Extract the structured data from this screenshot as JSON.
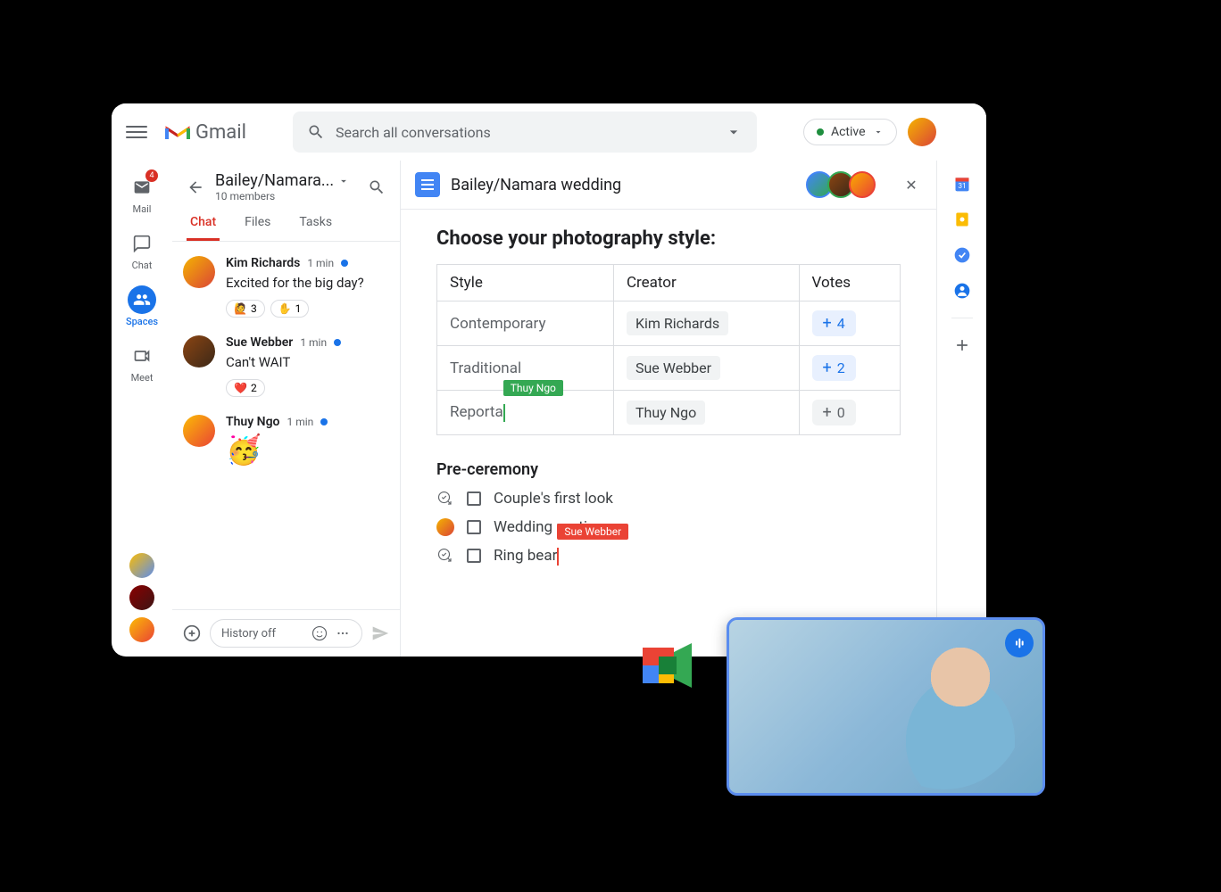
{
  "header": {
    "app_name": "Gmail",
    "search_placeholder": "Search all conversations",
    "status_label": "Active"
  },
  "nav": {
    "items": [
      {
        "label": "Mail",
        "badge": "4"
      },
      {
        "label": "Chat"
      },
      {
        "label": "Spaces"
      },
      {
        "label": "Meet"
      }
    ]
  },
  "space": {
    "title": "Bailey/Namara...",
    "members_text": "10 members",
    "tabs": [
      "Chat",
      "Files",
      "Tasks"
    ]
  },
  "messages": [
    {
      "author": "Kim Richards",
      "time": "1 min",
      "text": "Excited for the big day?",
      "reactions": [
        {
          "emoji": "🙋",
          "count": "3"
        },
        {
          "emoji": "✋",
          "count": "1"
        }
      ]
    },
    {
      "author": "Sue Webber",
      "time": "1 min",
      "text": "Can't WAIT",
      "reactions": [
        {
          "emoji": "❤️",
          "count": "2"
        }
      ]
    },
    {
      "author": "Thuy Ngo",
      "time": "1 min",
      "emoji": "🥳"
    }
  ],
  "compose": {
    "placeholder": "History off"
  },
  "document": {
    "title": "Bailey/Namara wedding",
    "heading": "Choose your photography style:",
    "table": {
      "headers": [
        "Style",
        "Creator",
        "Votes"
      ],
      "rows": [
        {
          "style": "Contemporary",
          "creator": "Kim Richards",
          "votes": "4"
        },
        {
          "style": "Traditional",
          "creator": "Sue Webber",
          "votes": "2"
        },
        {
          "style": "Reporta",
          "creator": "Thuy Ngo",
          "votes": "0",
          "cursor": "Thuy Ngo"
        }
      ]
    },
    "section": "Pre-ceremony",
    "checklist": [
      {
        "text": "Couple's first look"
      },
      {
        "text": "Wedding parties"
      },
      {
        "text": "Ring bear",
        "cursor": "Sue Webber"
      }
    ]
  }
}
